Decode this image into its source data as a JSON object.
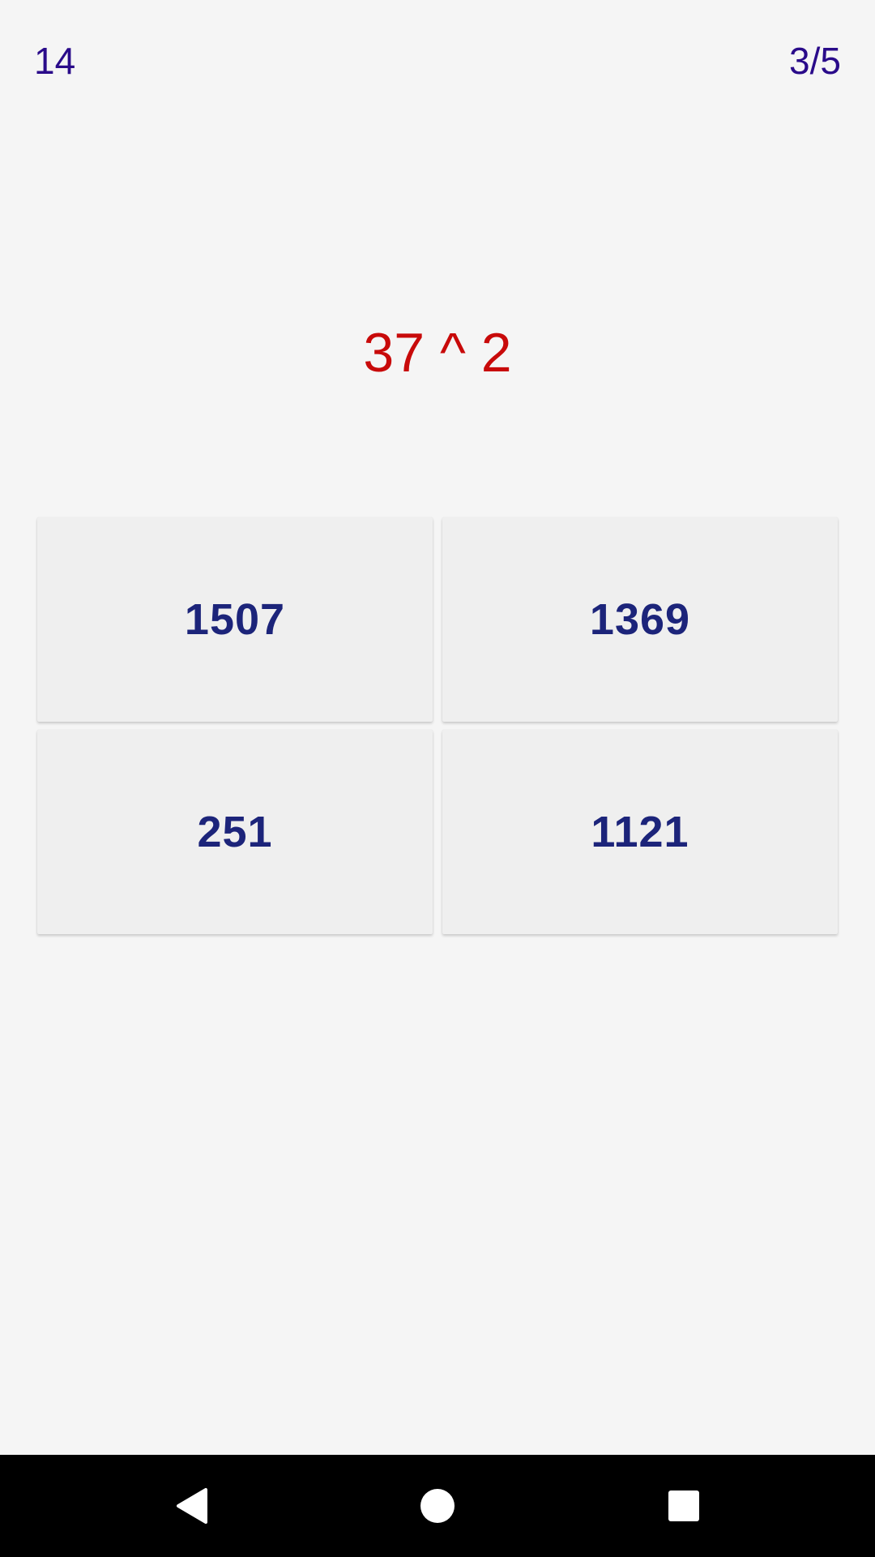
{
  "header": {
    "score": "14",
    "progress": "3/5"
  },
  "question": {
    "text": "37 ^ 2"
  },
  "answers": [
    {
      "label": "1507"
    },
    {
      "label": "1369"
    },
    {
      "label": "251"
    },
    {
      "label": "1121"
    }
  ],
  "navbar": {
    "back_icon": "back-triangle-icon",
    "home_icon": "home-circle-icon",
    "recents_icon": "recents-square-icon"
  },
  "colors": {
    "background": "#f5f5f5",
    "header_text": "#2a0b8a",
    "question_text": "#c80a0a",
    "answer_text": "#1c247a",
    "answer_bg": "#efefef",
    "navbar_bg": "#000000"
  }
}
